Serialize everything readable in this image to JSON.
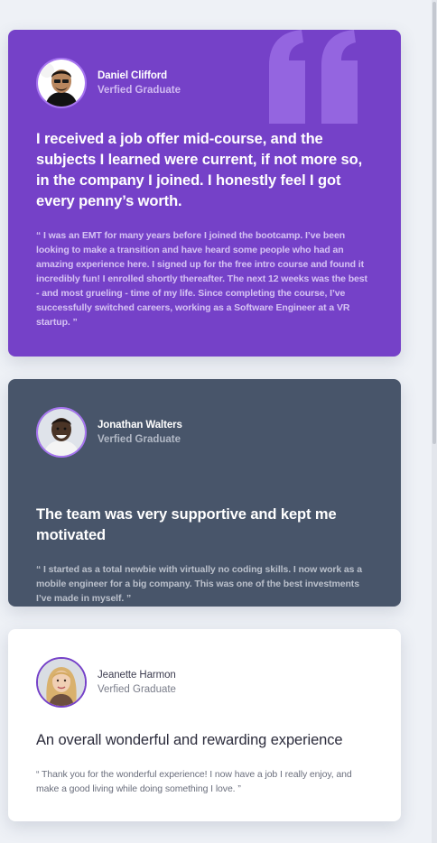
{
  "colors": {
    "page_background": "#eef1f6",
    "card_violet": "#7541c8",
    "card_slate": "#48556a",
    "card_white": "#ffffff",
    "accent_light_violet": "#a775f1"
  },
  "testimonials": [
    {
      "name": "Daniel Clifford",
      "role": "Verfied Graduate",
      "headline": "I received a job offer mid-course, and the subjects I learned were current, if not more so, in the company I joined. I honestly feel I got every penny’s worth.",
      "body": "“ I was an EMT for many years before I joined the bootcamp. I’ve been looking to make a transition and have heard some people who had an amazing experience here. I signed up for the free intro course and found it incredibly fun! I enrolled shortly thereafter. The next 12 weeks was the best - and most grueling - time of my life. Since completing the course, I’ve successfully switched careers, working as a Software Engineer at a VR startup. ”",
      "avatar_icon": "person-avatar-icon",
      "decoration_icon": "quotation-mark-icon"
    },
    {
      "name": "Jonathan Walters",
      "role": "Verfied Graduate",
      "headline": "The team was very supportive and kept me motivated",
      "body": "“ I started as a total newbie with virtually no coding skills. I now work as a mobile engineer for a big company. This was one of the best investments I’ve made in myself. ”",
      "avatar_icon": "person-avatar-icon"
    },
    {
      "name": "Jeanette Harmon",
      "role": "Verfied Graduate",
      "headline": "An overall wonderful and rewarding experience",
      "body": "“ Thank you for the wonderful experience! I now have a job I really enjoy, and make a good living while doing something I love. ”",
      "avatar_icon": "person-avatar-icon"
    }
  ]
}
